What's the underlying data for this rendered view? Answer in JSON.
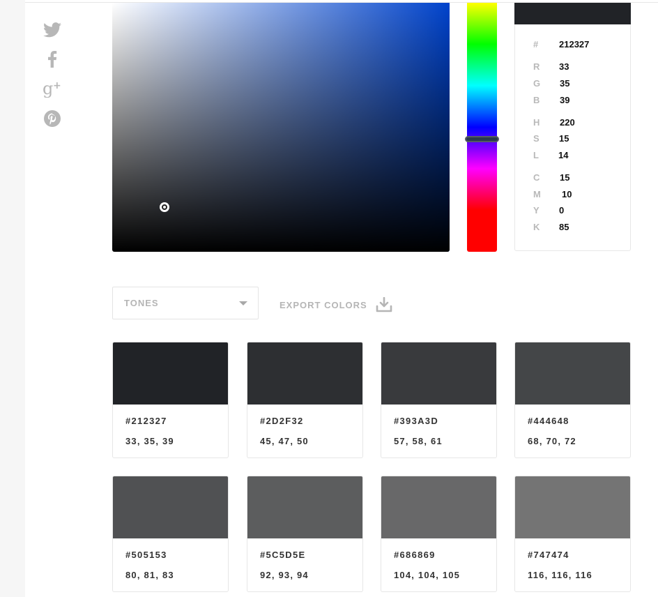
{
  "social": [
    {
      "name": "twitter-icon"
    },
    {
      "name": "facebook-icon"
    },
    {
      "name": "google-plus-icon"
    },
    {
      "name": "pinterest-icon"
    }
  ],
  "picker": {
    "hue_color": "#0043cc",
    "selected_color": "#212327",
    "hue_value": 220
  },
  "values": {
    "hex": {
      "label": "#",
      "value": "212327"
    },
    "r": {
      "label": "R",
      "value": "33"
    },
    "g": {
      "label": "G",
      "value": "35"
    },
    "b": {
      "label": "B",
      "value": "39"
    },
    "h": {
      "label": "H",
      "value": "220"
    },
    "s": {
      "label": "S",
      "value": "15"
    },
    "l": {
      "label": "L",
      "value": "14"
    },
    "c": {
      "label": "C",
      "value": "15"
    },
    "m": {
      "label": "M",
      "value": "10"
    },
    "y": {
      "label": "Y",
      "value": "0"
    },
    "kk": {
      "label": "K",
      "value": "85"
    }
  },
  "controls": {
    "tones_label": "TONES",
    "export_label": "EXPORT COLORS"
  },
  "tones": [
    {
      "hex": "#212327",
      "rgb": "33, 35, 39"
    },
    {
      "hex": "#2D2F32",
      "rgb": "45, 47, 50"
    },
    {
      "hex": "#393A3D",
      "rgb": "57, 58, 61"
    },
    {
      "hex": "#444648",
      "rgb": "68, 70, 72"
    },
    {
      "hex": "#505153",
      "rgb": "80, 81, 83"
    },
    {
      "hex": "#5C5D5E",
      "rgb": "92, 93, 94"
    },
    {
      "hex": "#686869",
      "rgb": "104, 104, 105"
    },
    {
      "hex": "#747474",
      "rgb": "116, 116, 116"
    }
  ]
}
